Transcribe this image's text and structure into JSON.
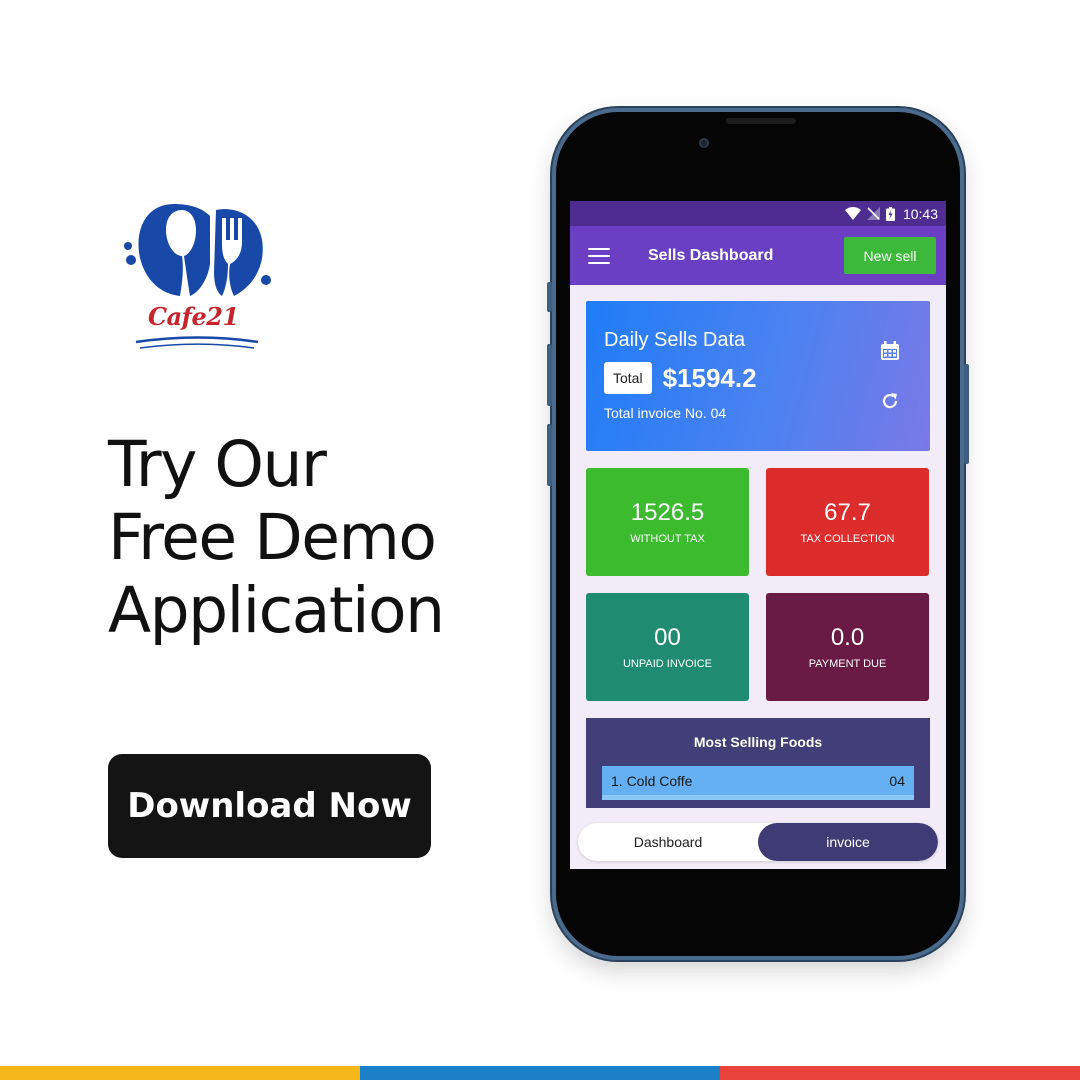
{
  "brand": {
    "logo_text": "Cafe21"
  },
  "headline": {
    "line1": "Try Our",
    "line2": "Free Demo",
    "line3": "Application"
  },
  "cta": {
    "label": "Download Now"
  },
  "phone": {
    "status": {
      "time": "10:43"
    },
    "appbar": {
      "title": "Sells Dashboard",
      "new_sell_label": "New sell"
    },
    "sales_card": {
      "title": "Daily Sells Data",
      "total_label": "Total",
      "total_amount": "$1594.2",
      "invoice_text": "Total invoice No. 04"
    },
    "stats": [
      {
        "value": "1526.5",
        "label": "WITHOUT TAX",
        "color": "#3dbb2f"
      },
      {
        "value": "67.7",
        "label": "TAX COLLECTION",
        "color": "#dc2c2c"
      },
      {
        "value": "00",
        "label": "UNPAID INVOICE",
        "color": "#1f8c72"
      },
      {
        "value": "0.0",
        "label": "PAYMENT DUE",
        "color": "#6a1b45"
      }
    ],
    "most_selling": {
      "title": "Most Selling Foods",
      "items": [
        {
          "name": "1. Cold Coffe",
          "count": "04"
        }
      ]
    },
    "bottom_nav": {
      "tab1": "Dashboard",
      "tab2": "invoice",
      "active": "invoice"
    }
  },
  "colors": {
    "appbar": "#6a3fc4",
    "statusbar": "#4f2c91",
    "new_sell": "#3cb83a",
    "strip": [
      "#f6b71b",
      "#1b80c8",
      "#e8423b"
    ]
  }
}
